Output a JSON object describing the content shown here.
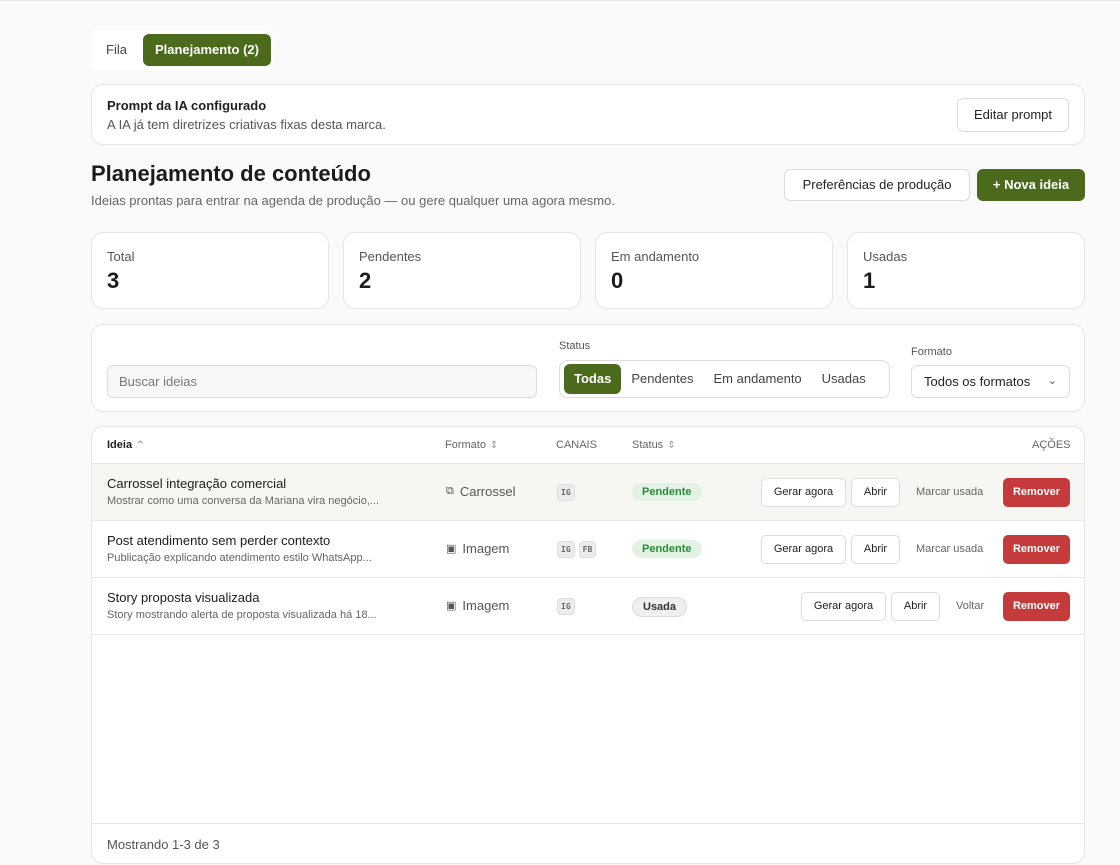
{
  "tabs": [
    {
      "label": "Fila"
    },
    {
      "label": "Planejamento (2)"
    }
  ],
  "prompt_card": {
    "title": "Prompt da IA configurado",
    "subtitle": "A IA já tem diretrizes criativas fixas desta marca.",
    "edit_label": "Editar prompt"
  },
  "header": {
    "title": "Planejamento de conteúdo",
    "subtitle": "Ideias prontas para entrar na agenda de produção — ou gere qualquer uma agora mesmo.",
    "prefs_label": "Preferências de produção",
    "new_label": "+ Nova ideia"
  },
  "stats": [
    {
      "label": "Total",
      "value": "3"
    },
    {
      "label": "Pendentes",
      "value": "2"
    },
    {
      "label": "Em andamento",
      "value": "0"
    },
    {
      "label": "Usadas",
      "value": "1"
    }
  ],
  "filters": {
    "search_placeholder": "Buscar ideias",
    "status_label": "Status",
    "status_options": [
      "Todas",
      "Pendentes",
      "Em andamento",
      "Usadas"
    ],
    "format_label": "Formato",
    "format_value": "Todos os formatos"
  },
  "table": {
    "headers": {
      "idea": "Ideia",
      "format": "Formato",
      "channels": "CANAIS",
      "status": "Status",
      "actions": "AÇÕES"
    },
    "rows": [
      {
        "title": "Carrossel integração comercial",
        "desc": "Mostrar como uma conversa da Mariana vira negócio,...",
        "format": "Carrossel",
        "channels": [
          "IG"
        ],
        "status": "Pendente",
        "generate": "Gerar agora",
        "open": "Abrir",
        "secondary": "Marcar usada",
        "remove": "Remover"
      },
      {
        "title": "Post atendimento sem perder contexto",
        "desc": "Publicação explicando atendimento estilo WhatsApp...",
        "format": "Imagem",
        "channels": [
          "IG",
          "FB"
        ],
        "status": "Pendente",
        "generate": "Gerar agora",
        "open": "Abrir",
        "secondary": "Marcar usada",
        "remove": "Remover"
      },
      {
        "title": "Story proposta visualizada",
        "desc": "Story mostrando alerta de proposta visualizada há 18...",
        "format": "Imagem",
        "channels": [
          "IG"
        ],
        "status": "Usada",
        "generate": "Gerar agora",
        "open": "Abrir",
        "secondary": "Voltar",
        "remove": "Remover"
      }
    ],
    "footer": "Mostrando 1-3 de 3"
  },
  "colors": {
    "accent": "#4b6a1c",
    "danger": "#c53a3a",
    "pending_bg": "#e3f3e3",
    "pending_fg": "#2d8a3a"
  },
  "icons": {
    "carousel": "copy-icon",
    "image": "image-icon",
    "sort": "sort-icon",
    "chevron": "chevron-down-icon"
  }
}
